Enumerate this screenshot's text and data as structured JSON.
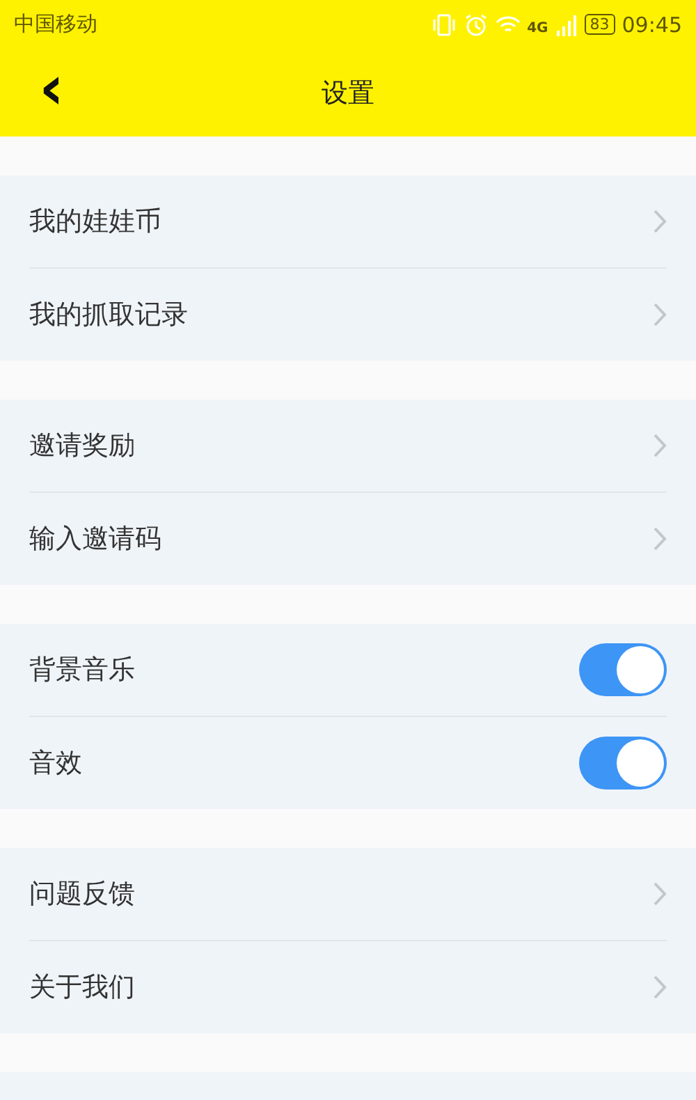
{
  "status_bar": {
    "carrier": "中国移动",
    "network": "4G",
    "battery": "83",
    "time": "09:45"
  },
  "header": {
    "back": "‹",
    "title": "设置"
  },
  "groups": [
    {
      "items": [
        {
          "kind": "link",
          "label": "我的娃娃币"
        },
        {
          "kind": "link",
          "label": "我的抓取记录"
        }
      ]
    },
    {
      "items": [
        {
          "kind": "link",
          "label": "邀请奖励"
        },
        {
          "kind": "link",
          "label": "输入邀请码"
        }
      ]
    },
    {
      "items": [
        {
          "kind": "toggle",
          "label": "背景音乐",
          "on": true
        },
        {
          "kind": "toggle",
          "label": "音效",
          "on": true
        }
      ]
    },
    {
      "items": [
        {
          "kind": "link",
          "label": "问题反馈"
        },
        {
          "kind": "link",
          "label": "关于我们"
        }
      ]
    }
  ]
}
